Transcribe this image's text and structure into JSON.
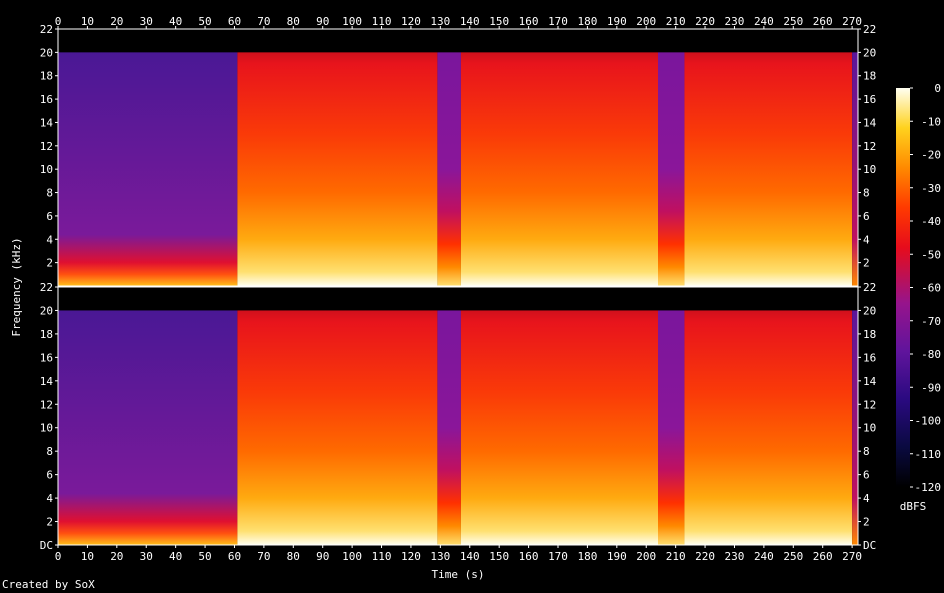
{
  "chart_data": {
    "type": "heatmap",
    "title": "",
    "xlabel": "Time (s)",
    "ylabel": "Frequency (kHz)",
    "xlim": [
      0,
      272
    ],
    "ylim": [
      0,
      22
    ],
    "x_ticks": [
      0,
      10,
      20,
      30,
      40,
      50,
      60,
      70,
      80,
      90,
      100,
      110,
      120,
      130,
      140,
      150,
      160,
      170,
      180,
      190,
      200,
      210,
      220,
      230,
      240,
      250,
      260,
      270
    ],
    "y_ticks": [
      {
        "v": 0,
        "label": "DC"
      },
      {
        "v": 2,
        "label": "2"
      },
      {
        "v": 4,
        "label": "4"
      },
      {
        "v": 6,
        "label": "6"
      },
      {
        "v": 8,
        "label": "8"
      },
      {
        "v": 10,
        "label": "10"
      },
      {
        "v": 12,
        "label": "12"
      },
      {
        "v": 14,
        "label": "14"
      },
      {
        "v": 16,
        "label": "16"
      },
      {
        "v": 18,
        "label": "18"
      },
      {
        "v": 20,
        "label": "20"
      },
      {
        "v": 22,
        "label": "22"
      }
    ],
    "channels": 2,
    "colorbar": {
      "label": "dBFS",
      "range": [
        -120,
        0
      ],
      "ticks": [
        0,
        -10,
        -20,
        -30,
        -40,
        -50,
        -60,
        -70,
        -80,
        -90,
        -100,
        -110,
        -120
      ]
    },
    "segments": [
      {
        "start": 0,
        "end": 61,
        "level": "low",
        "bandwidth_khz": 20
      },
      {
        "start": 61,
        "end": 129,
        "level": "high",
        "bandwidth_khz": 20
      },
      {
        "start": 129,
        "end": 137,
        "level": "dip",
        "bandwidth_khz": 20
      },
      {
        "start": 137,
        "end": 204,
        "level": "high",
        "bandwidth_khz": 20
      },
      {
        "start": 204,
        "end": 213,
        "level": "dip",
        "bandwidth_khz": 20
      },
      {
        "start": 213,
        "end": 270,
        "level": "high",
        "bandwidth_khz": 20
      },
      {
        "start": 270,
        "end": 272,
        "level": "fade",
        "bandwidth_khz": 20
      }
    ]
  },
  "footer": {
    "credit": "Created by SoX"
  }
}
